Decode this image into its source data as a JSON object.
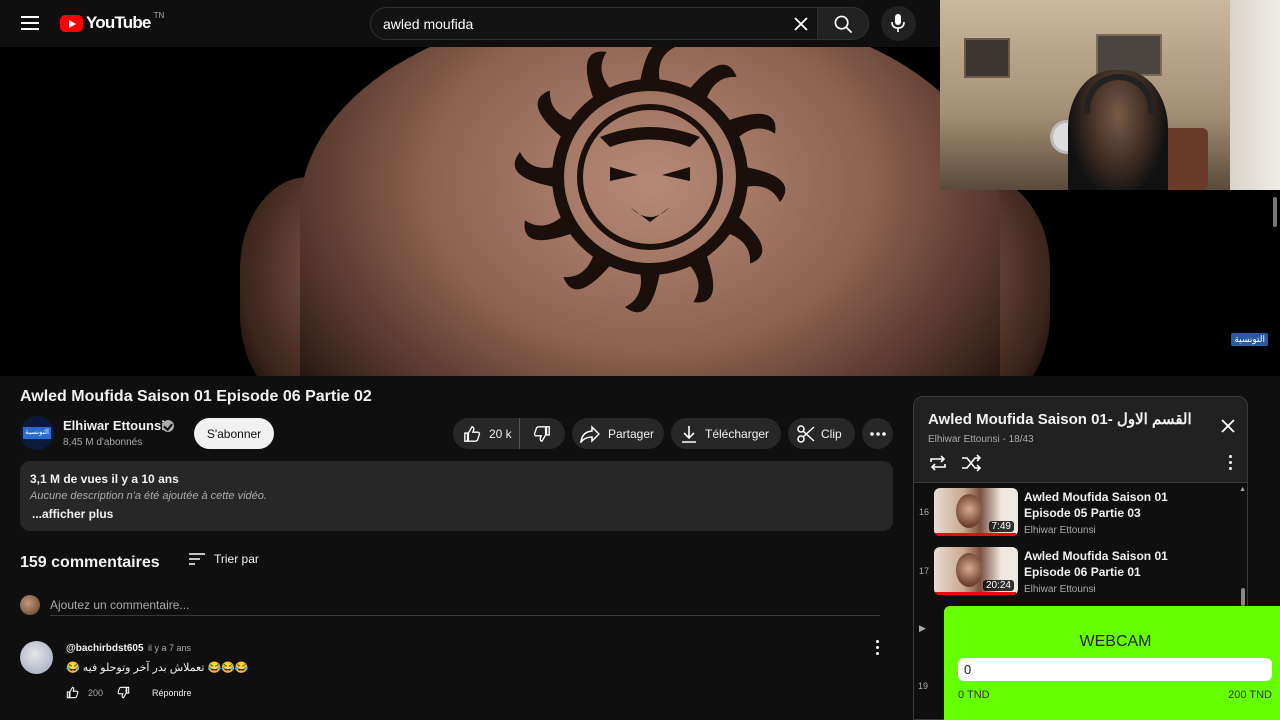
{
  "header": {
    "logo_text": "YouTube",
    "country": "TN",
    "search_value": "awled moufida"
  },
  "video": {
    "watermark": "التونسية",
    "title": "Awled Moufida Saison 01 Episode 06 Partie 02",
    "channel_name": "Elhiwar Ettounsi",
    "channel_avatar_text": "التونسية",
    "subscribers": "8,45 M d'abonnés",
    "subscribe_label": "S'abonner",
    "likes": "20 k",
    "share_label": "Partager",
    "download_label": "Télécharger",
    "clip_label": "Clip"
  },
  "description": {
    "stats": "3,1 M de vues  il y a 10 ans",
    "text": "Aucune description n'a été ajoutée à cette vidéo.",
    "show_more": "...afficher plus"
  },
  "comments": {
    "count_label": "159 commentaires",
    "sort_label": "Trier par",
    "add_placeholder": "Ajoutez un commentaire...",
    "items": [
      {
        "author": "@bachirbdst605",
        "time": "il y a 7 ans",
        "text": "😂😂😂 تعملاش بدر آخر وتوحلو فيه 😂",
        "likes": "200",
        "reply_label": "Répondre"
      }
    ]
  },
  "playlist": {
    "title": "Awled Moufida Saison 01- القسم الاول",
    "subtitle": "Elhiwar Ettounsi - 18/43",
    "items": [
      {
        "index": "16",
        "title": "Awled Moufida Saison 01 Episode 05 Partie 03",
        "channel": "Elhiwar Ettounsi",
        "duration": "7:49",
        "watched": 0.98
      },
      {
        "index": "17",
        "title": "Awled Moufida Saison 01 Episode 06 Partie 01",
        "channel": "Elhiwar Ettounsi",
        "duration": "20:24",
        "watched": 0.98
      }
    ],
    "partial_index": "19"
  },
  "donation": {
    "title": "WEBCAM",
    "current": "0",
    "min_label": "0 TND",
    "max_label": "200 TND",
    "progress": 0
  },
  "colors": {
    "background": "#0f0f0f",
    "accent_red": "#ff0000",
    "widget_green": "#66ff00",
    "pill": "#272727"
  }
}
